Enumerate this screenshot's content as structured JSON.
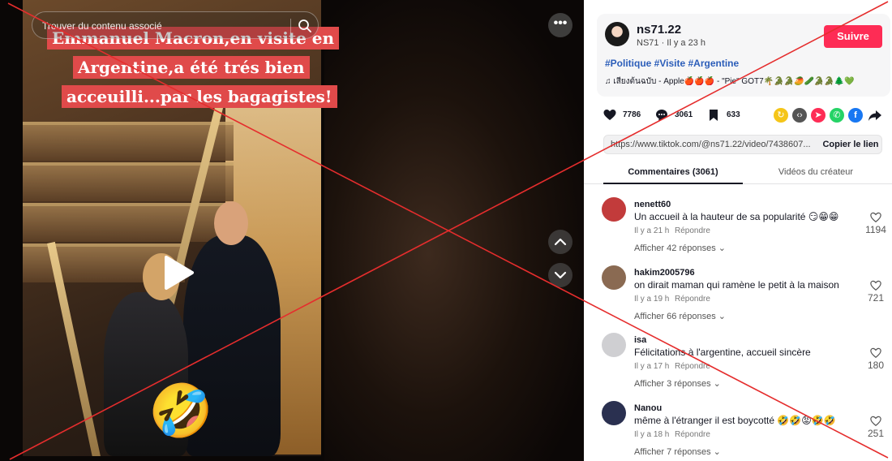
{
  "search": {
    "placeholder": "Trouver du contenu associé"
  },
  "video": {
    "caption_lines": [
      "Emmanuel Macron,en visite en",
      "Argentine,a été trés bien",
      "acceuilli...par les bagagistes!"
    ],
    "emoji": "🤣",
    "more_label": "•••"
  },
  "author": {
    "username": "ns71.22",
    "meta": "NS71 · Il y a 23 h",
    "follow_label": "Suivre",
    "hashtags": "#Politique #Visite #Argentine",
    "music": "♫  เสียงต้นฉบับ - Apple🍎🍎🍎 - \"Pie\" GOT7🌴🐊🐊🥭🥒🐊🐊🌲💚"
  },
  "actions": {
    "likes": "7786",
    "comments": "3061",
    "saves": "633"
  },
  "share_colors": {
    "repost": "#f5c518",
    "embed": "#555555",
    "send": "#fe2c55",
    "whatsapp": "#25d366",
    "facebook": "#1877f2"
  },
  "link": {
    "url": "https://www.tiktok.com/@ns71.22/video/7438607...",
    "copy_label": "Copier le lien"
  },
  "tabs": {
    "comments": "Commentaires (3061)",
    "creator_videos": "Vidéos du créateur"
  },
  "comments": [
    {
      "name": "nenett60",
      "text": "Un accueil à la hauteur de sa popularité 😏😁😁",
      "time": "Il y a 21 h",
      "reply": "Répondre",
      "more": "Afficher 42 réponses ⌄",
      "likes": "1194",
      "avatar_color": "#c23b3b"
    },
    {
      "name": "hakim2005796",
      "text": "on dirait maman qui ramène le petit à la maison",
      "time": "Il y a 19 h",
      "reply": "Répondre",
      "more": "Afficher 66 réponses ⌄",
      "likes": "721",
      "avatar_color": "#8a6a52"
    },
    {
      "name": "isa",
      "text": "Félicitations à l'argentine, accueil sincère",
      "time": "Il y a 17 h",
      "reply": "Répondre",
      "more": "Afficher 3 réponses ⌄",
      "likes": "180",
      "avatar_color": "#cfcfd2"
    },
    {
      "name": "Nanou",
      "text": "même à l'étranger il est boycotté 🤣🤣😡🤣🤣",
      "time": "Il y a 18 h",
      "reply": "Répondre",
      "more": "Afficher 7 réponses ⌄",
      "likes": "251",
      "avatar_color": "#2a3050"
    }
  ]
}
